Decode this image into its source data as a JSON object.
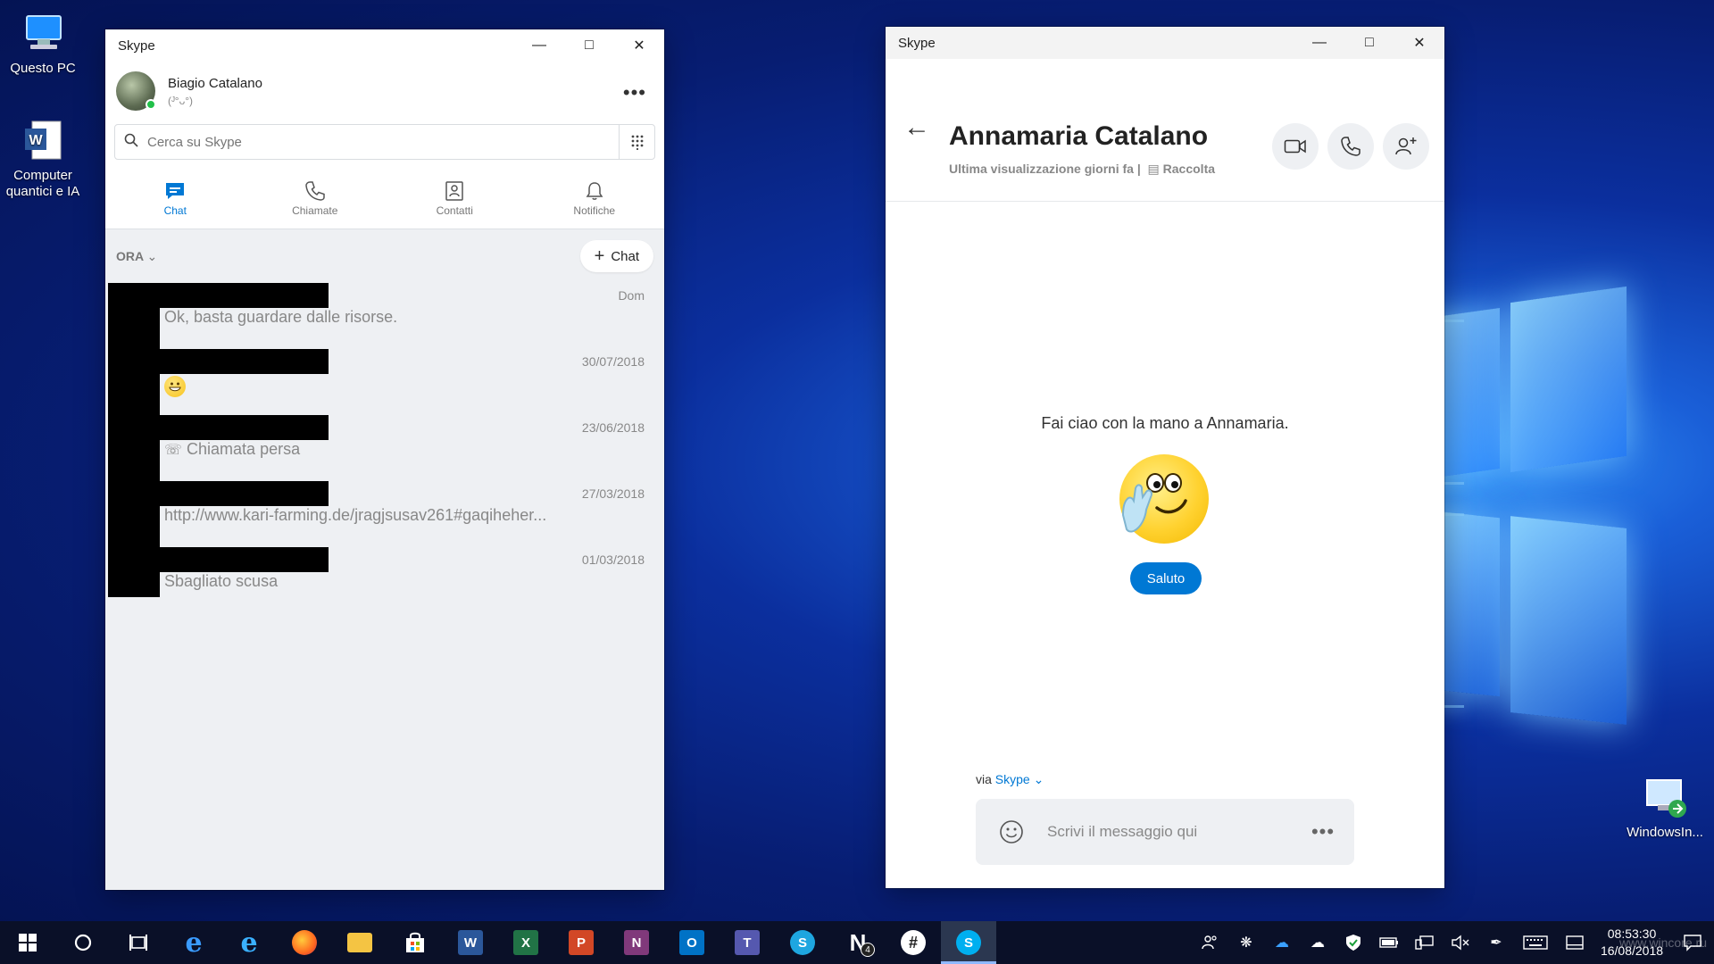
{
  "desktop": {
    "icons": [
      {
        "label": "Questo PC",
        "icon": "computer-icon"
      },
      {
        "label": "Computer quantici e IA",
        "icon": "word-document-icon"
      },
      {
        "label": "WindowsIn...",
        "icon": "remote-desktop-icon"
      }
    ],
    "watermark": "www.wincore.ru"
  },
  "left_window": {
    "title": "Skype",
    "profile": {
      "name": "Biagio Catalano",
      "mood": "(ᴶ°ᴗ°)",
      "status_color": "#22c04a"
    },
    "search": {
      "placeholder": "Cerca su Skype"
    },
    "tabs": [
      {
        "label": "Chat",
        "icon": "chat-icon",
        "active": true
      },
      {
        "label": "Chiamate",
        "icon": "phone-icon",
        "active": false
      },
      {
        "label": "Contatti",
        "icon": "contacts-icon",
        "active": false
      },
      {
        "label": "Notifiche",
        "icon": "bell-icon",
        "active": false
      }
    ],
    "section_label": "ORA",
    "new_chat_label": "Chat",
    "chats": [
      {
        "date": "Dom",
        "preview": "Ok, basta guardare dalle risorse."
      },
      {
        "date": "30/07/2018",
        "preview": "",
        "preview_icon": "grin-emoji-icon"
      },
      {
        "date": "23/06/2018",
        "preview": "Chiamata persa",
        "preview_icon": "missed-call-icon"
      },
      {
        "date": "27/03/2018",
        "preview": "http://www.kari-farming.de/jragjsusav261#gaqiheher..."
      },
      {
        "date": "01/03/2018",
        "preview": "Sbagliato scusa"
      }
    ],
    "accent": "#0078d4"
  },
  "right_window": {
    "title": "Skype",
    "contact_name": "Annamaria Catalano",
    "last_seen": "Ultima visualizzazione giorni fa |",
    "gallery_label": "Raccolta",
    "wave_text": "Fai ciao con la mano a Annamaria.",
    "wave_button": "Saluto",
    "via_prefix": "via",
    "via_link": "Skype",
    "composer_placeholder": "Scrivi il messaggio qui"
  },
  "taskbar": {
    "apps": [
      "start",
      "cortana",
      "task-view",
      "edge",
      "internet-explorer",
      "firefox",
      "file-explorer",
      "store",
      "word",
      "excel",
      "powerpoint",
      "onenote",
      "outlook",
      "teams",
      "skype-business",
      "notifier",
      "slack",
      "skype"
    ],
    "notifier_badge": "4",
    "clock_time": "08:53:30",
    "clock_date": "16/08/2018"
  }
}
